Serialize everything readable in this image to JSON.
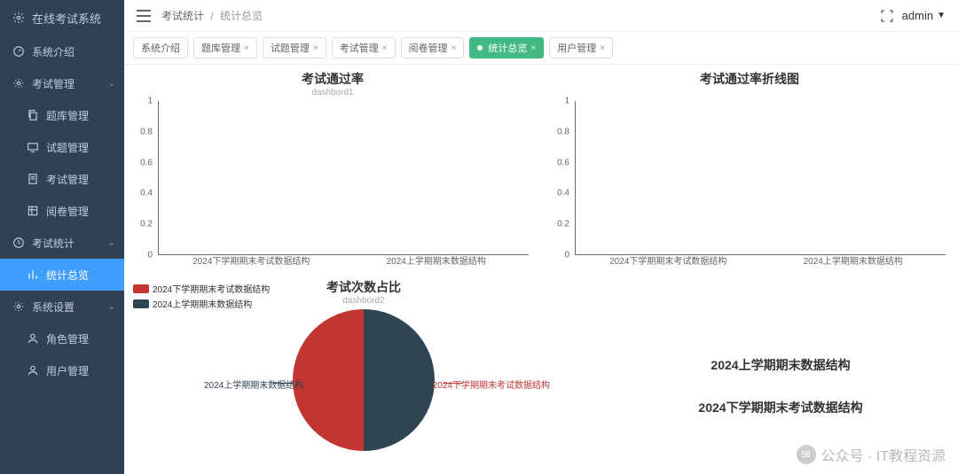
{
  "brand": "在线考试系统",
  "sidebar": [
    {
      "label": "系统介绍",
      "icon": "dash",
      "type": "item"
    },
    {
      "label": "考试管理",
      "icon": "gear",
      "type": "group",
      "children": [
        {
          "label": "题库管理",
          "icon": "copy"
        },
        {
          "label": "试题管理",
          "icon": "screen"
        },
        {
          "label": "考试管理",
          "icon": "doc"
        },
        {
          "label": "阅卷管理",
          "icon": "sheet"
        }
      ]
    },
    {
      "label": "考试统计",
      "icon": "clock",
      "type": "group",
      "children": [
        {
          "label": "统计总览",
          "icon": "chart",
          "active": true
        }
      ]
    },
    {
      "label": "系统设置",
      "icon": "gear",
      "type": "group",
      "children": [
        {
          "label": "角色管理",
          "icon": "user"
        },
        {
          "label": "用户管理",
          "icon": "user"
        }
      ]
    }
  ],
  "breadcrumb": {
    "root": "考试统计",
    "current": "统计总览"
  },
  "user": "admin",
  "tabs": [
    {
      "label": "系统介绍"
    },
    {
      "label": "题库管理",
      "closable": true
    },
    {
      "label": "试题管理",
      "closable": true
    },
    {
      "label": "考试管理",
      "closable": true
    },
    {
      "label": "阅卷管理",
      "closable": true
    },
    {
      "label": "统计总览",
      "closable": true,
      "active": true
    },
    {
      "label": "用户管理",
      "closable": true
    }
  ],
  "chart_data": [
    {
      "type": "bar",
      "title": "考试通过率",
      "subtitle": "dashbord1",
      "categories": [
        "2024下学期期末考试数据结构",
        "2024上学期期末数据结构"
      ],
      "values": [
        0,
        0
      ],
      "ylim": [
        0,
        1
      ],
      "yticks": [
        0,
        0.2,
        0.4,
        0.6,
        0.8,
        1
      ]
    },
    {
      "type": "bar",
      "title": "考试通过率折线图",
      "categories": [
        "2024下学期期末考试数据结构",
        "2024上学期期末数据结构"
      ],
      "values": [
        0,
        0
      ],
      "ylim": [
        0,
        1
      ],
      "yticks": [
        0,
        0.2,
        0.4,
        0.6,
        0.8,
        1
      ]
    },
    {
      "type": "pie",
      "title": "考试次数占比",
      "subtitle": "dashbord2",
      "series": [
        {
          "name": "2024下学期期末考试数据结构",
          "value": 1,
          "color": "#c23531"
        },
        {
          "name": "2024上学期期末数据结构",
          "value": 1,
          "color": "#2f4554"
        }
      ]
    }
  ],
  "rank_list": [
    "2024上学期期末数据结构",
    "2024下学期期末考试数据结构"
  ],
  "watermark": "公众号 · IT教程资源"
}
